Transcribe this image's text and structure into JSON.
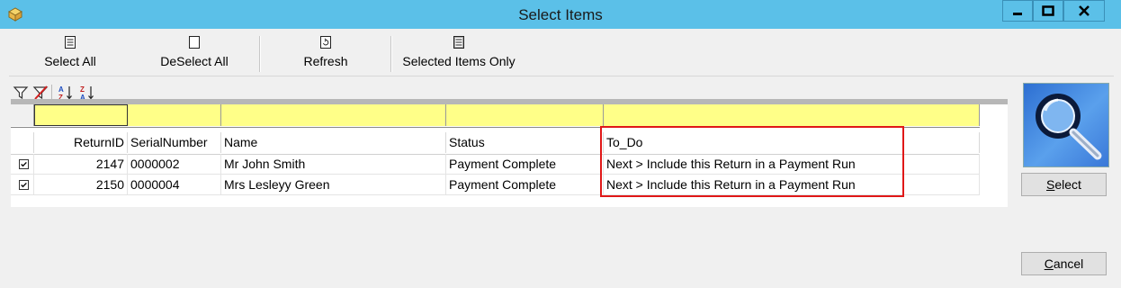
{
  "window": {
    "title": "Select Items"
  },
  "toolbar": {
    "select_all": "Select All",
    "deselect_all": "DeSelect All",
    "refresh": "Refresh",
    "selected_items_only": "Selected Items Only"
  },
  "grid": {
    "columns": [
      "ReturnID",
      "SerialNumber",
      "Name",
      "Status",
      "To_Do"
    ],
    "rows": [
      {
        "checked": true,
        "ReturnID": "2147",
        "SerialNumber": "0000002",
        "Name": "Mr John Smith",
        "Status": "Payment Complete",
        "To_Do": "Next > Include this Return in a Payment Run"
      },
      {
        "checked": true,
        "ReturnID": "2150",
        "SerialNumber": "0000004",
        "Name": "Mrs Lesleyy Green",
        "Status": "Payment Complete",
        "To_Do": "Next > Include this Return in a Payment Run"
      }
    ]
  },
  "side": {
    "select_first": "S",
    "select_rest": "elect",
    "cancel_first": "C",
    "cancel_rest": "ancel"
  },
  "colors": {
    "titlebar": "#5bc0e8",
    "filter_row": "#ffff88",
    "highlight": "#e01818"
  },
  "icons": [
    "app-icon",
    "minimize-icon",
    "maximize-icon",
    "close-icon",
    "filter-icon",
    "clear-filter-icon",
    "sort-ascending-icon",
    "sort-descending-icon",
    "magnifier-icon"
  ]
}
